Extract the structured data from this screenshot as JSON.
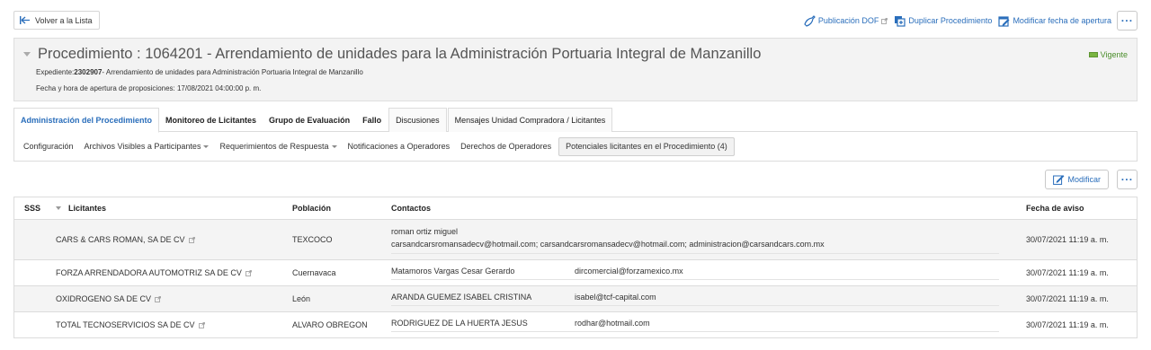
{
  "topbar": {
    "back_label": "Volver a la Lista",
    "links": [
      {
        "label": "Publicación DOF",
        "icon": "publication-icon",
        "external": true
      },
      {
        "label": "Duplicar Procedimiento",
        "icon": "duplicate-icon",
        "external": false
      },
      {
        "label": "Modificar fecha de apertura",
        "icon": "calendar-edit-icon",
        "external": false
      }
    ],
    "more_label": "···"
  },
  "header": {
    "title": "Procedimiento : 1064201 - Arrendamiento de unidades para la Administración Portuaria Integral de Manzanillo",
    "status": "Vigente",
    "expediente_label": "Expediente:",
    "expediente_number": "2302907",
    "expediente_desc": "- Arrendamiento de unidades para Administración Portuaria Integral de Manzanillo",
    "apertura": "Fecha y hora de apertura de proposiciones: 17/08/2021 04:00:00 p. m."
  },
  "tabs": [
    {
      "label": "Administración del Procedimiento",
      "active": true
    },
    {
      "label": "Monitoreo de Licitantes"
    },
    {
      "label": "Grupo de Evaluación"
    },
    {
      "label": "Fallo"
    },
    {
      "label": "Discusiones"
    },
    {
      "label": "Mensajes Unidad Compradora / Licitantes"
    }
  ],
  "subnav": [
    {
      "label": "Configuración"
    },
    {
      "label": "Archivos Visibles a Participantes",
      "dropdown": true
    },
    {
      "label": "Requerimientos de Respuesta",
      "dropdown": true
    },
    {
      "label": "Notificaciones a Operadores"
    },
    {
      "label": "Derechos de Operadores"
    },
    {
      "label": "Potenciales licitantes en el Procedimiento (4)",
      "active": true
    }
  ],
  "actions": {
    "modify_label": "Modificar",
    "more_label": "···"
  },
  "table": {
    "headers": {
      "sss": "SSS",
      "licitantes": "Licitantes",
      "poblacion": "Población",
      "contactos": "Contactos",
      "fecha": "Fecha de aviso"
    },
    "rows": [
      {
        "licitante": "CARS & CARS ROMAN, SA DE CV",
        "poblacion": "TEXCOCO",
        "contact_name": "roman ortiz miguel",
        "contact_email": "carsandcarsromansadecv@hotmail.com; carsandcarsromansadecv@hotmail.com; administracion@carsandcars.com.mx",
        "fecha": "30/07/2021 11:19 a. m."
      },
      {
        "licitante": "FORZA ARRENDADORA AUTOMOTRIZ SA DE CV",
        "poblacion": "Cuernavaca",
        "contact_name": "Matamoros Vargas Cesar Gerardo",
        "contact_email": "dircomercial@forzamexico.mx",
        "fecha": "30/07/2021 11:19 a. m."
      },
      {
        "licitante": "OXIDROGENO SA DE CV",
        "poblacion": "León",
        "contact_name": "ARANDA GUEMEZ ISABEL CRISTINA",
        "contact_email": "isabel@tcf-capital.com",
        "fecha": "30/07/2021 11:19 a. m."
      },
      {
        "licitante": "TOTAL TECNOSERVICIOS SA DE CV",
        "poblacion": "ALVARO OBREGON",
        "contact_name": "RODRIGUEZ DE LA HUERTA JESUS",
        "contact_email": "rodhar@hotmail.com",
        "fecha": "30/07/2021 11:19 a. m."
      }
    ]
  },
  "colors": {
    "link": "#2a6ebb",
    "status": "#4a8d2a",
    "panel_bg": "#f3f3f3",
    "alt_row": "#f4f4f4"
  }
}
